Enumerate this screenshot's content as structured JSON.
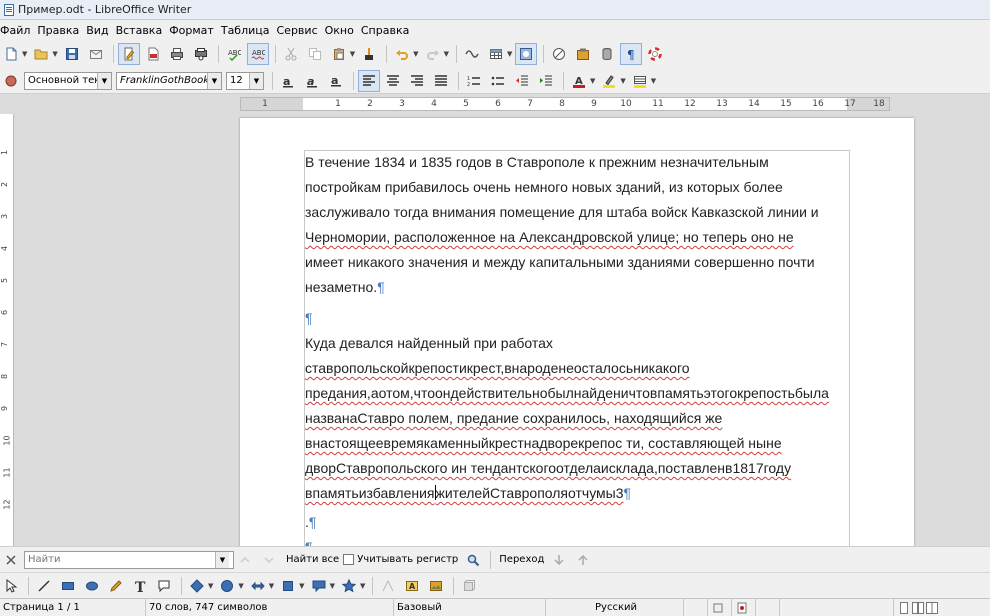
{
  "window": {
    "title": "Пример.odt - LibreOffice Writer"
  },
  "menu": [
    "Файл",
    "Правка",
    "Вид",
    "Вставка",
    "Формат",
    "Таблица",
    "Сервис",
    "Окно",
    "Справка"
  ],
  "format_bar": {
    "paragraph_style": "Основной текст",
    "font_name": "FranklinGothBookTT",
    "font_size": "12"
  },
  "ruler": {
    "h_labels": [
      "1",
      "1",
      "2",
      "3",
      "4",
      "5",
      "6",
      "7",
      "8",
      "9",
      "10",
      "11",
      "12",
      "13",
      "14",
      "15",
      "16",
      "17",
      "18"
    ],
    "v_labels": [
      "1",
      "2",
      "3",
      "4",
      "5",
      "6",
      "7",
      "8",
      "9",
      "10",
      "11",
      "12"
    ]
  },
  "document": {
    "para1_lines": [
      "В течение 1834 и 1835 годов в Ставрополе к прежним незначительным",
      "постройкам прибавилось очень немного новых зданий, из которых более",
      "заслуживало тогда внимания помещение для штаба войск Кавказской линии и",
      "Черномории, расположенное на Александровской улице; но теперь оно не",
      "имеет никакого значения и между капитальными зданиями совершенно почти",
      "незаметно."
    ],
    "para2_lines": [
      "Куда девался найденный при работах",
      "ставропольскойкрепостикрест,внароденеосталосьникакого",
      "предания,аотом,чтоондействительнобылнайденичтовпамятьэтогокрепостьбыла",
      "названаСтавро полем, предание сохранилось, находящийся же",
      "внастоящеевремякаменныйкрестнадворекрепос ти, составляющей ныне",
      "дворСтавропольского ин тендантскогоотделаисклада,поставленв1817году",
      "впамятьизбавления",
      "жителейСтаврополяотчумы3"
    ],
    "para3": ".",
    "pilcrow": "¶"
  },
  "findbar": {
    "placeholder": "Найти",
    "find_all": "Найти все",
    "match_case": "Учитывать регистр",
    "navigate": "Переход"
  },
  "statusbar": {
    "page": "Страница 1 / 1",
    "words": "70 слов, 747 символов",
    "style": "Базовый",
    "language": "Русский"
  }
}
